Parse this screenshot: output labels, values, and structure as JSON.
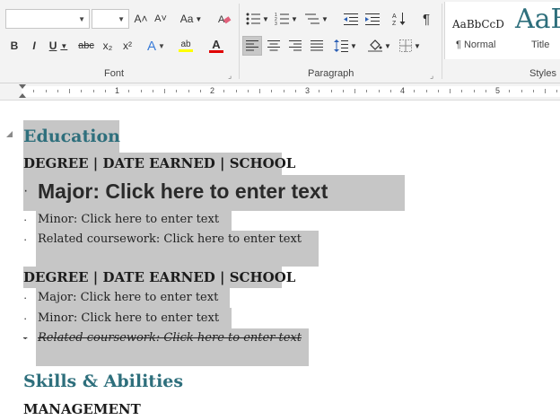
{
  "ribbon": {
    "font_group_label": "Font",
    "paragraph_group_label": "Paragraph",
    "styles_group_label": "Styles",
    "font_name_value": "",
    "font_size_value": "",
    "grow_font": "A˄",
    "shrink_font": "A˅",
    "change_case": "Aa",
    "bold": "B",
    "italic": "I",
    "underline": "U",
    "strikethrough": "abc",
    "subscript": "x₂",
    "superscript": "x²",
    "text_effects": "A",
    "highlight": "ab",
    "font_color": "A",
    "show_marks": "¶",
    "styles": [
      {
        "preview": "AaBbCcD",
        "name": "¶ Normal"
      },
      {
        "preview": "AaB",
        "name": "Title"
      }
    ]
  },
  "ruler": {
    "numbers": [
      "1",
      "2",
      "3",
      "4",
      "5"
    ]
  },
  "document": {
    "heading_education": "Education",
    "entry1": {
      "degree_line": "DEGREE | DATE EARNED | SCHOOL",
      "major": "Major: Click here to enter text",
      "minor": "Minor: Click here to enter text",
      "coursework": "Related coursework: Click here to enter text"
    },
    "entry2": {
      "degree_line": "DEGREE | DATE EARNED | SCHOOL",
      "major": "Major: Click here to enter text",
      "minor": "Minor: Click here to enter text",
      "coursework": "Related coursework: Click here to enter text"
    },
    "heading_skills": "Skills & Abilities",
    "subheading_management": "MANAGEMENT"
  },
  "colors": {
    "heading": "#2e6f7c",
    "selection": "#c6c6c6",
    "font_color_bar": "#e00000",
    "highlight_bar": "#ffff00"
  }
}
